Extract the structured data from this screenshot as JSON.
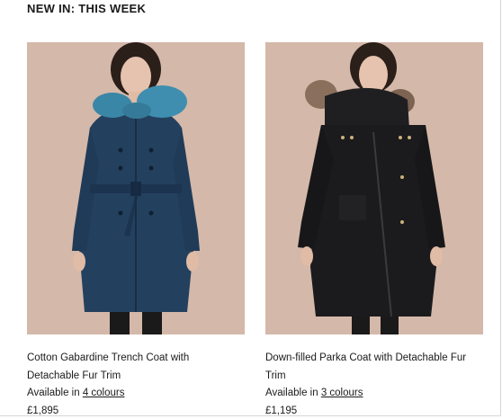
{
  "section_title": "NEW IN: THIS WEEK",
  "products": [
    {
      "name": "Cotton Gabardine Trench Coat with Detachable Fur Trim",
      "availability_prefix": "Available in ",
      "colours_link": "4 colours",
      "price": "£1,895",
      "image_alt": "model wearing navy trench coat with blue fur collar"
    },
    {
      "name": "Down-filled Parka Coat with Detachable Fur Trim",
      "availability_prefix": "Available in ",
      "colours_link": "3 colours",
      "price": "£1,195",
      "image_alt": "model wearing black parka with fur-trimmed hood"
    }
  ],
  "colors": {
    "photo_background": "#d4b8a9",
    "trench_navy": "#23415f",
    "fur_blue": "#3a86a6",
    "parka_black": "#1b1b1d",
    "fur_brown": "#8a6f5c"
  }
}
